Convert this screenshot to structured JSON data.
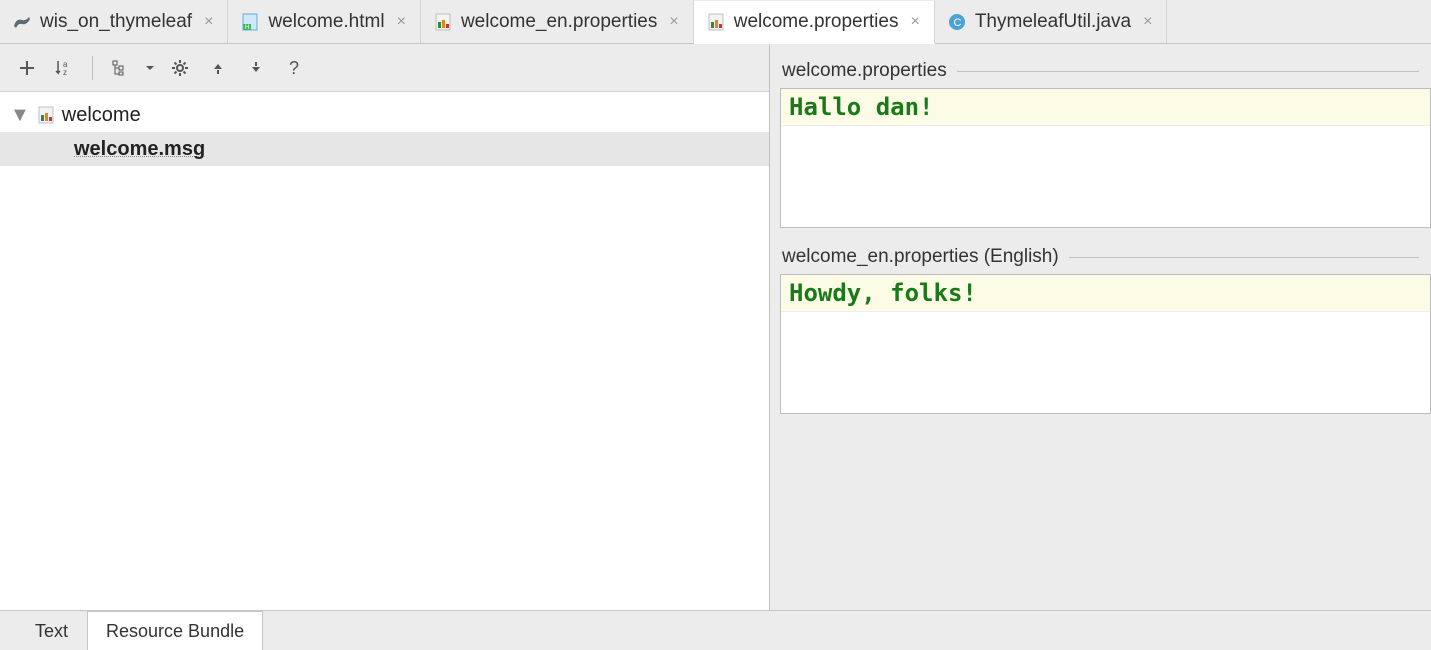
{
  "tabs": [
    {
      "label": "wis_on_thymeleaf",
      "icon": "gradle"
    },
    {
      "label": "welcome.html",
      "icon": "html"
    },
    {
      "label": "welcome_en.properties",
      "icon": "props"
    },
    {
      "label": "welcome.properties",
      "icon": "props",
      "active": true
    },
    {
      "label": "ThymeleafUtil.java",
      "icon": "java"
    }
  ],
  "tree": {
    "root_label": "welcome",
    "selected_key": "welcome.msg"
  },
  "editors": [
    {
      "title": "welcome.properties",
      "value": "Hallo dan!"
    },
    {
      "title": "welcome_en.properties (English)",
      "value": "Howdy, folks!"
    }
  ],
  "bottom_tabs": {
    "text": "Text",
    "bundle": "Resource Bundle"
  }
}
